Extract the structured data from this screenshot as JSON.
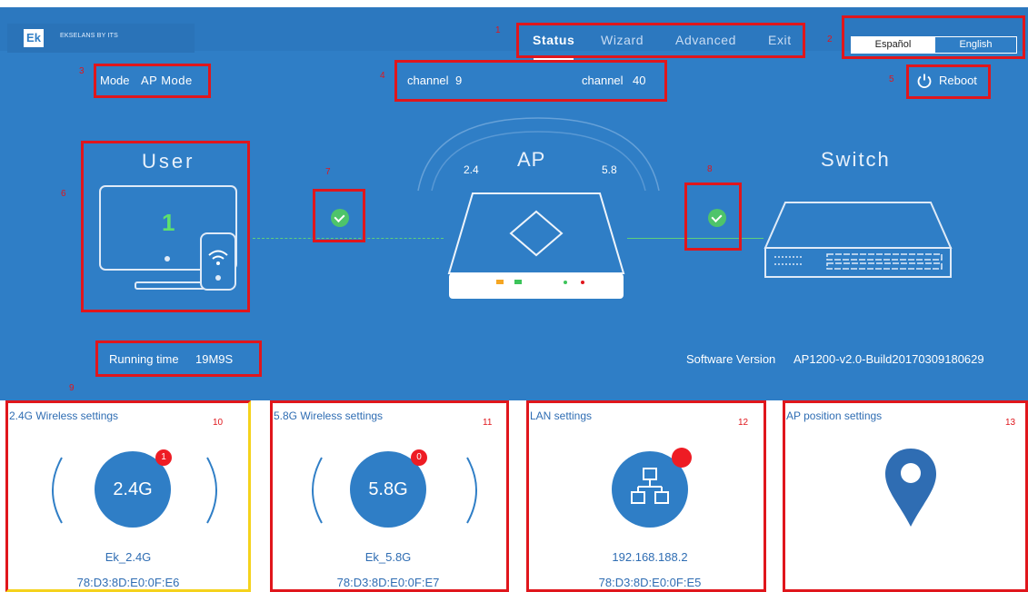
{
  "brand": {
    "logo_mark": "Ek",
    "logo_text": "EKSELANS BY ITS"
  },
  "nav": {
    "items": [
      "Status",
      "Wizard",
      "Advanced",
      "Exit"
    ],
    "active": "Status"
  },
  "language": {
    "options": [
      "Español",
      "English"
    ],
    "selected": "English"
  },
  "header": {
    "mode_label": "Mode",
    "mode_value": "AP Mode",
    "channel_24_label": "channel",
    "channel_24_value": "9",
    "channel_58_label": "channel",
    "channel_58_value": "40",
    "reboot_label": "Reboot"
  },
  "topology": {
    "user_title": "User",
    "user_count": "1",
    "ap_title": "AP",
    "band_24": "2.4",
    "band_58": "5.8",
    "switch_title": "Switch"
  },
  "status": {
    "running_label": "Running time",
    "running_value": "19M9S",
    "software_label": "Software Version",
    "software_value": "AP1200-v2.0-Build20170309180629"
  },
  "annotations": [
    "1",
    "2",
    "3",
    "4",
    "5",
    "6",
    "7",
    "8",
    "9",
    "10",
    "11",
    "12",
    "13"
  ],
  "cards": [
    {
      "title": "2.4G Wireless settings",
      "circle_label": "2.4G",
      "badge": "1",
      "line1": "Ek_2.4G",
      "line2": "78:D3:8D:E0:0F:E6"
    },
    {
      "title": "5.8G Wireless settings",
      "circle_label": "5.8G",
      "badge": "0",
      "line1": "Ek_5.8G",
      "line2": "78:D3:8D:E0:0F:E7"
    },
    {
      "title": "LAN settings",
      "line1": "192.168.188.2",
      "line2": "78:D3:8D:E0:0F:E5"
    },
    {
      "title": "AP position settings"
    }
  ],
  "colors": {
    "hero": "#2f7ec6",
    "annotation": "#e0161c",
    "ok": "#4ec46a",
    "badge": "#ee1c24",
    "text_blue": "#2f6db3"
  }
}
